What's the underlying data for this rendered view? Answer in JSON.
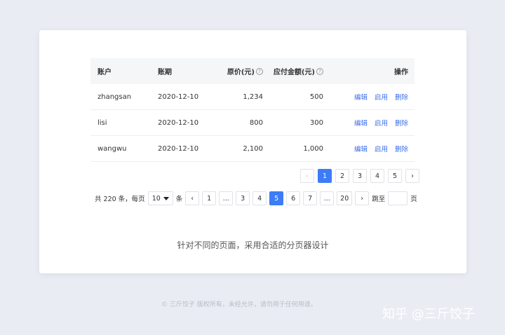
{
  "table": {
    "headers": {
      "account": "账户",
      "period": "账期",
      "price": "原价(元)",
      "payable": "应付金额(元)",
      "ops": "操作"
    },
    "rows": [
      {
        "account": "zhangsan",
        "period": "2020-12-10",
        "price": "1,234",
        "payable": "500",
        "edit": "编辑",
        "enable": "启用",
        "delete": "删除"
      },
      {
        "account": "lisi",
        "period": "2020-12-10",
        "price": "800",
        "payable": "300",
        "edit": "编辑",
        "enable": "启用",
        "delete": "删除"
      },
      {
        "account": "wangwu",
        "period": "2020-12-10",
        "price": "2,100",
        "payable": "1,000",
        "edit": "编辑",
        "enable": "启用",
        "delete": "删除"
      }
    ]
  },
  "pager1": {
    "pages": [
      "1",
      "2",
      "3",
      "4",
      "5"
    ],
    "current": "1"
  },
  "pager2": {
    "total_text": "共 220 条，每页",
    "page_size": "10",
    "unit": "条",
    "pages": [
      "1",
      "...",
      "3",
      "4",
      "5",
      "6",
      "7",
      "...",
      "20"
    ],
    "current": "5",
    "jump_label": "跳至",
    "page_suffix": "页"
  },
  "caption": "针对不同的页面，采用合适的分页器设计",
  "footer": "© 三斤饺子  版权所有，未经允许，请勿用于任何用途。",
  "watermark": "知乎 @三斤饺子",
  "icons": {
    "prev": "chevron-left-icon",
    "next": "chevron-right-icon",
    "help": "question-circle-icon",
    "dropdown": "caret-down-icon"
  },
  "colors": {
    "accent": "#3c7cf6",
    "link": "#3c6fe8",
    "background": "#e9ecf3"
  }
}
